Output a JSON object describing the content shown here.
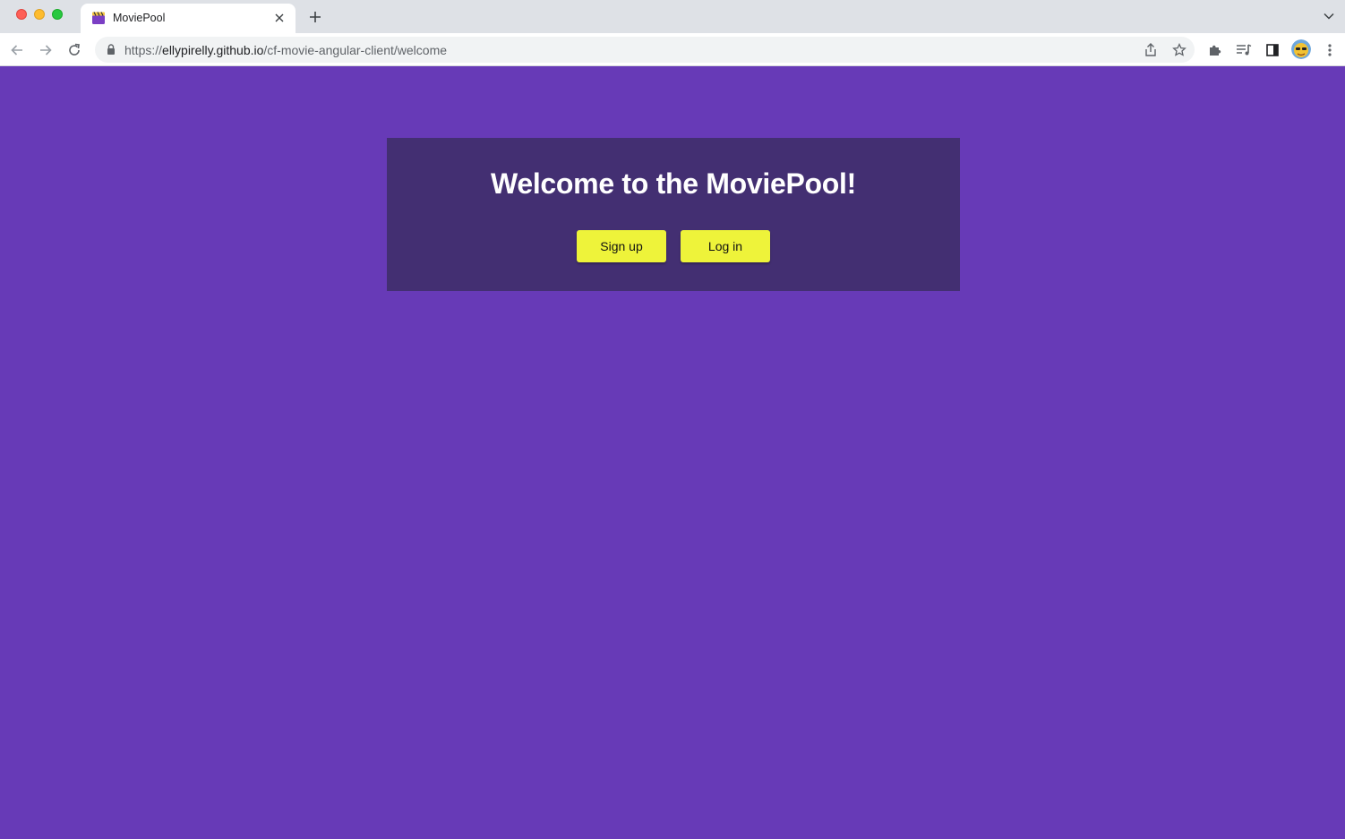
{
  "browser": {
    "tab": {
      "title": "MoviePool",
      "favicon": "clapperboard-icon"
    },
    "url": {
      "scheme": "https://",
      "host": "ellypirelly.github.io",
      "path": "/cf-movie-angular-client/welcome"
    }
  },
  "page": {
    "title": "Welcome to the MoviePool!",
    "buttons": {
      "signup": "Sign up",
      "login": "Log in"
    }
  },
  "colors": {
    "background": "#673ab7",
    "card": "#432f72",
    "button": "#eef33a"
  }
}
